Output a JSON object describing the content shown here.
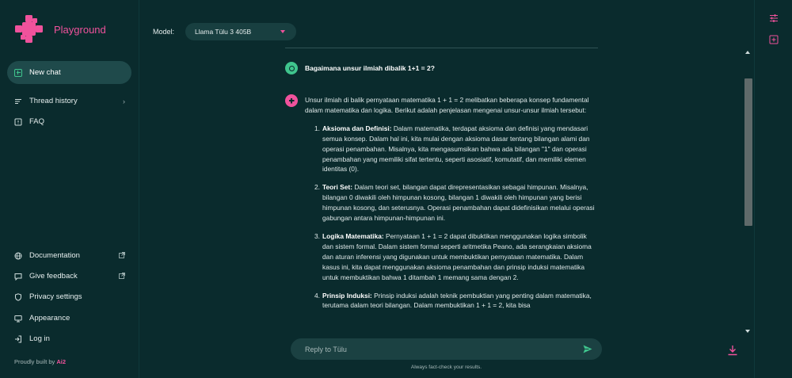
{
  "brand": {
    "name": "Playground"
  },
  "sidebar": {
    "new_chat": "New chat",
    "top_items": [
      {
        "label": "Thread history",
        "icon": "list-icon"
      },
      {
        "label": "FAQ",
        "icon": "help-icon"
      }
    ],
    "bottom_items": [
      {
        "label": "Documentation",
        "icon": "globe-icon"
      },
      {
        "label": "Give feedback",
        "icon": "feedback-icon"
      },
      {
        "label": "Privacy settings",
        "icon": "shield-icon"
      },
      {
        "label": "Appearance",
        "icon": "monitor-icon"
      },
      {
        "label": "Log in",
        "icon": "login-icon"
      }
    ],
    "footer_prefix": "Proudly built by",
    "footer_brand": "Ai2"
  },
  "model": {
    "label": "Model:",
    "selected": "Llama Tülu 3 405B"
  },
  "chat": {
    "user_message": "Bagaimana unsur ilmiah dibalik 1+1 = 2?",
    "intro": "Unsur ilmiah di balik pernyataan matematika 1 + 1 = 2 melibatkan beberapa konsep fundamental dalam matematika dan logika. Berikut adalah penjelasan mengenai unsur-unsur ilmiah tersebut:",
    "items": [
      {
        "num": "1.",
        "title": "Aksioma dan Definisi:",
        "text": " Dalam matematika, terdapat aksioma dan definisi yang mendasari semua konsep. Dalam hal ini, kita mulai dengan aksioma dasar tentang bilangan alami dan operasi penambahan. Misalnya, kita mengasumsikan bahwa ada bilangan \"1\" dan operasi penambahan yang memiliki sifat tertentu, seperti asosiatif, komutatif, dan memiliki elemen identitas (0)."
      },
      {
        "num": "2.",
        "title": "Teori Set:",
        "text": " Dalam teori set, bilangan dapat direpresentasikan sebagai himpunan. Misalnya, bilangan 0 diwakili oleh himpunan kosong, bilangan 1 diwakili oleh himpunan yang berisi himpunan kosong, dan seterusnya. Operasi penambahan dapat didefinisikan melalui operasi gabungan antara himpunan-himpunan ini."
      },
      {
        "num": "3.",
        "title": "Logika Matematika:",
        "text": " Pernyataan 1 + 1 = 2 dapat dibuktikan menggunakan logika simbolik dan sistem formal. Dalam sistem formal seperti aritmetika Peano, ada serangkaian aksioma dan aturan inferensi yang digunakan untuk membuktikan pernyataan matematika. Dalam kasus ini, kita dapat menggunakan aksioma penambahan dan prinsip induksi matematika untuk membuktikan bahwa 1 ditambah 1 memang sama dengan 2."
      },
      {
        "num": "4.",
        "title": "Prinsip Induksi:",
        "text": " Prinsip induksi adalah teknik pembuktian yang penting dalam matematika, terutama dalam teori bilangan. Dalam membuktikan 1 + 1 = 2, kita bisa"
      }
    ]
  },
  "input": {
    "placeholder": "Reply to Tülu",
    "value": ""
  },
  "disclaimer": "Always fact-check your results.",
  "colors": {
    "accent": "#f0529c",
    "green": "#3fc48d",
    "background": "#0a2b2d"
  }
}
